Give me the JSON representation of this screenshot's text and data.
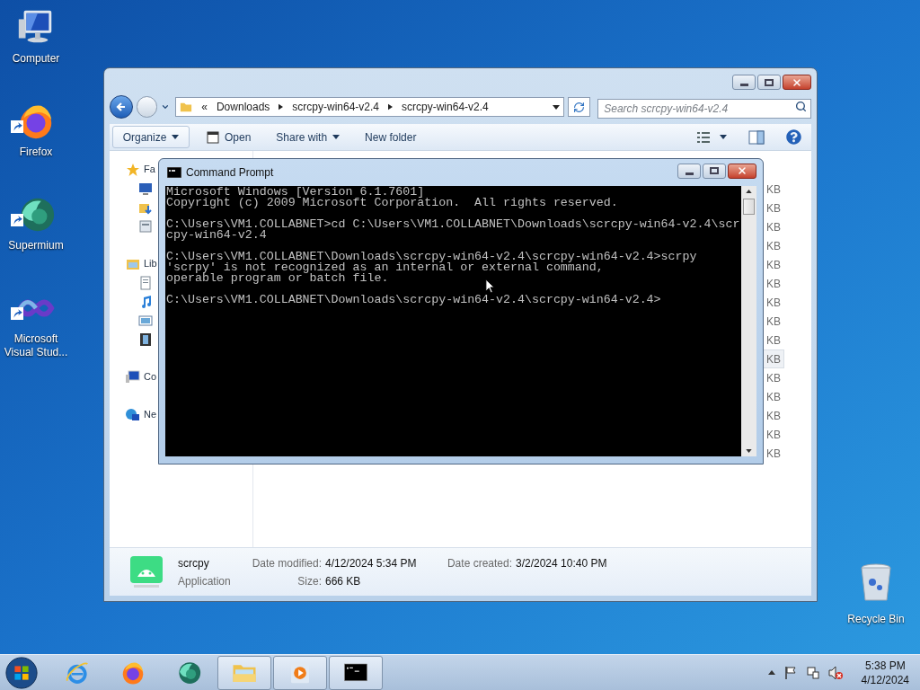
{
  "desktop_icons": [
    {
      "label": "Computer",
      "kind": "computer",
      "shortcut": false
    },
    {
      "label": "Firefox",
      "kind": "firefox",
      "shortcut": true
    },
    {
      "label": "Supermium",
      "kind": "supermium",
      "shortcut": true
    },
    {
      "label": "Microsoft Visual Stud...",
      "kind": "visual-studio",
      "shortcut": true
    }
  ],
  "recycle_bin": {
    "label": "Recycle Bin"
  },
  "explorer": {
    "address": {
      "overflow": "«",
      "segments": [
        "Downloads",
        "scrcpy-win64-v2.4",
        "scrcpy-win64-v2.4"
      ]
    },
    "search": {
      "placeholder": "Search scrcpy-win64-v2.4"
    },
    "toolbar": [
      {
        "label": "Organize",
        "kind": "menu",
        "hovered": true
      },
      {
        "label": "Open",
        "kind": "open",
        "hovered": false
      },
      {
        "label": "Share with",
        "kind": "menu",
        "hovered": false
      },
      {
        "label": "New folder",
        "kind": "plain",
        "hovered": false
      }
    ],
    "nav": [
      {
        "label": "Fa",
        "kind": "favorites",
        "children": [
          {
            "kind": "desktop"
          },
          {
            "kind": "downloads"
          },
          {
            "kind": "recent"
          }
        ]
      },
      {
        "label": "Lib",
        "kind": "libraries",
        "children": [
          {
            "kind": "documents"
          },
          {
            "kind": "music"
          },
          {
            "kind": "pictures"
          },
          {
            "kind": "videos"
          }
        ]
      },
      {
        "label": "Co",
        "kind": "computer"
      },
      {
        "label": "Ne",
        "kind": "network"
      }
    ],
    "file_sizes": [
      {
        "text": "KB",
        "selected": false
      },
      {
        "text": "KB",
        "selected": false
      },
      {
        "text": "KB",
        "selected": false
      },
      {
        "text": "KB",
        "selected": false
      },
      {
        "text": "KB",
        "selected": false
      },
      {
        "text": "KB",
        "selected": false
      },
      {
        "text": "KB",
        "selected": false
      },
      {
        "text": "KB",
        "selected": false
      },
      {
        "text": "KB",
        "selected": false
      },
      {
        "text": "KB",
        "selected": true
      },
      {
        "text": "KB",
        "selected": false
      },
      {
        "text": "KB",
        "selected": false
      },
      {
        "text": "KB",
        "selected": false
      },
      {
        "text": "KB",
        "selected": false
      },
      {
        "text": "KB",
        "selected": false
      }
    ],
    "details": {
      "name": "scrcpy",
      "type": "Application",
      "fields": [
        {
          "label": "Date modified:",
          "value": "4/12/2024 5:34 PM"
        },
        {
          "label": "Date created:",
          "value": "3/2/2024 10:40 PM"
        },
        {
          "label": "Size:",
          "value": "666 KB"
        }
      ]
    }
  },
  "command_prompt": {
    "title": "Command Prompt",
    "blocks": [
      [
        "Microsoft Windows [Version 6.1.7601]",
        "Copyright (c) 2009 Microsoft Corporation.  All rights reserved."
      ],
      [
        "C:\\Users\\VM1.COLLABNET>cd C:\\Users\\VM1.COLLABNET\\Downloads\\scrcpy-win64-v2.4\\scr",
        "cpy-win64-v2.4"
      ],
      [
        "C:\\Users\\VM1.COLLABNET\\Downloads\\scrcpy-win64-v2.4\\scrcpy-win64-v2.4>scrpy",
        "'scrpy' is not recognized as an internal or external command,",
        "operable program or batch file."
      ],
      [
        "C:\\Users\\VM1.COLLABNET\\Downloads\\scrcpy-win64-v2.4\\scrcpy-win64-v2.4>"
      ]
    ]
  },
  "taskbar": {
    "items": [
      {
        "kind": "internet-explorer",
        "open": false
      },
      {
        "kind": "firefox",
        "open": false
      },
      {
        "kind": "supermium",
        "open": false
      },
      {
        "kind": "explorer",
        "open": true
      },
      {
        "kind": "media-player",
        "open": true
      },
      {
        "kind": "console",
        "open": true
      }
    ],
    "volume_muted": true,
    "clock": {
      "time": "5:38 PM",
      "date": "4/12/2024"
    }
  }
}
